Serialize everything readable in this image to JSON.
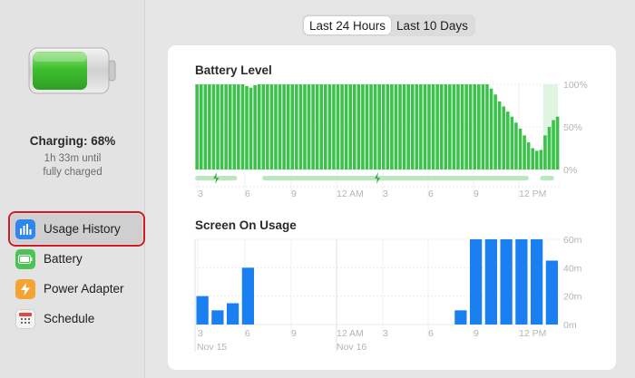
{
  "colors": {
    "battery_green": "#3ac24a",
    "battery_green_light": "#b8e8bd",
    "screen_blue": "#1a7ff0",
    "selection_outline": "#d11a23"
  },
  "sidebar": {
    "battery_icon": "battery-charging-icon",
    "charge_title": "Charging: 68%",
    "charge_sub_line1": "1h 33m until",
    "charge_sub_line2": "fully charged",
    "items": [
      {
        "label": "Usage History",
        "icon": "bar-chart-icon",
        "selected": true
      },
      {
        "label": "Battery",
        "icon": "battery-icon",
        "selected": false
      },
      {
        "label": "Power Adapter",
        "icon": "lightning-icon",
        "selected": false
      },
      {
        "label": "Schedule",
        "icon": "calendar-icon",
        "selected": false
      }
    ]
  },
  "range_selector": {
    "options": [
      "Last 24 Hours",
      "Last 10 Days"
    ],
    "selected": "Last 24 Hours"
  },
  "charts": {
    "battery_title": "Battery Level",
    "screen_title": "Screen On Usage"
  },
  "chart_data": [
    {
      "type": "bar",
      "title": "Battery Level",
      "y_ticks": [
        "100%",
        "50%",
        "0%"
      ],
      "ylim": [
        0,
        100
      ],
      "x_tick_labels": [
        "3",
        "6",
        "9",
        "12 AM",
        "3",
        "6",
        "9",
        "12 PM"
      ],
      "values": [
        100,
        100,
        100,
        100,
        100,
        100,
        100,
        100,
        100,
        100,
        100,
        100,
        98,
        96,
        99,
        100,
        100,
        100,
        100,
        100,
        100,
        100,
        100,
        100,
        100,
        100,
        100,
        100,
        100,
        100,
        100,
        100,
        100,
        100,
        100,
        100,
        100,
        100,
        100,
        100,
        100,
        100,
        100,
        100,
        100,
        100,
        100,
        100,
        100,
        100,
        100,
        100,
        100,
        100,
        100,
        100,
        100,
        100,
        100,
        100,
        100,
        100,
        100,
        100,
        100,
        100,
        100,
        100,
        100,
        100,
        100,
        95,
        88,
        80,
        74,
        68,
        62,
        55,
        48,
        40,
        32,
        25,
        22,
        23,
        40,
        50,
        58,
        62
      ],
      "charging_shaded_last_bars": 4,
      "charging_segments_hours": [
        [
          0,
          1.5
        ],
        [
          2.4,
          11.9
        ],
        [
          12.3,
          12.8
        ]
      ]
    },
    {
      "type": "bar",
      "title": "Screen On Usage",
      "y_ticks": [
        "60m",
        "40m",
        "20m",
        "0m"
      ],
      "ylim": [
        0,
        60
      ],
      "x_tick_labels": [
        "3",
        "6",
        "9",
        "12 AM",
        "3",
        "6",
        "9",
        "12 PM"
      ],
      "date_labels": [
        "Nov 15",
        "Nov 16"
      ],
      "hours": [
        0,
        1,
        2,
        3,
        4,
        5,
        6,
        7,
        8,
        9,
        10,
        11,
        12,
        13,
        14,
        15,
        16,
        17,
        18,
        19,
        20,
        21,
        22,
        23
      ],
      "values": [
        20,
        10,
        15,
        40,
        0,
        0,
        0,
        0,
        0,
        0,
        0,
        0,
        0,
        0,
        0,
        0,
        0,
        10,
        60,
        60,
        60,
        60,
        60,
        45
      ]
    }
  ]
}
